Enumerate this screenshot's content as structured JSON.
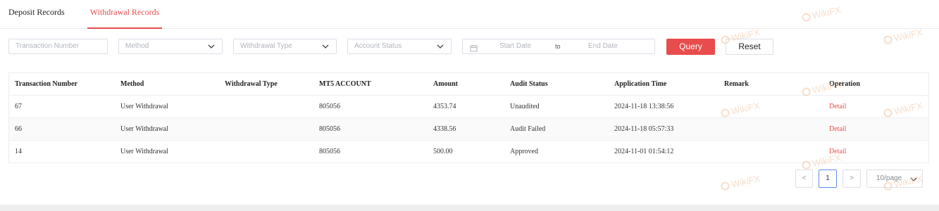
{
  "tabs": [
    {
      "label": "Deposit Records",
      "active": false
    },
    {
      "label": "Withdrawal Records",
      "active": true
    }
  ],
  "filters": {
    "transaction_number_placeholder": "Transaction Number",
    "method_placeholder": "Method",
    "withdrawal_type_placeholder": "Withdrawal Type",
    "account_status_placeholder": "Account Status",
    "start_date_placeholder": "Start Date",
    "to_label": "to",
    "end_date_placeholder": "End Date",
    "query_label": "Query",
    "reset_label": "Reset"
  },
  "table": {
    "headers": [
      "Transaction Number",
      "Method",
      "Withdrawal Type",
      "MT5 ACCOUNT",
      "Amount",
      "Audit Status",
      "Application Time",
      "Remark",
      "Operation"
    ],
    "rows": [
      {
        "transaction_number": "67",
        "method": "User Withdrawal",
        "withdrawal_type": "",
        "mt5_account": "805056",
        "amount": "4353.74",
        "audit_status": "Unaudited",
        "application_time": "2024-11-18 13:38:56",
        "remark": "",
        "operation": "Detail"
      },
      {
        "transaction_number": "66",
        "method": "User Withdrawal",
        "withdrawal_type": "",
        "mt5_account": "805056",
        "amount": "4338.56",
        "audit_status": "Audit Failed",
        "application_time": "2024-11-18 05:57:33",
        "remark": "",
        "operation": "Detail"
      },
      {
        "transaction_number": "14",
        "method": "User Withdrawal",
        "withdrawal_type": "",
        "mt5_account": "805056",
        "amount": "500.00",
        "audit_status": "Approved",
        "application_time": "2024-11-01 01:54:12",
        "remark": "",
        "operation": "Detail"
      }
    ]
  },
  "pagination": {
    "prev_symbol": "<",
    "current_page": "1",
    "next_symbol": ">",
    "page_size": "10/page"
  },
  "watermark": {
    "text": "WikiFX",
    "icon": "wikifx-logo-icon"
  },
  "colors": {
    "accent": "#e84c4c",
    "border": "#dcdfe6",
    "active_page_border": "#5b8def",
    "footer": "#eeeeee"
  }
}
